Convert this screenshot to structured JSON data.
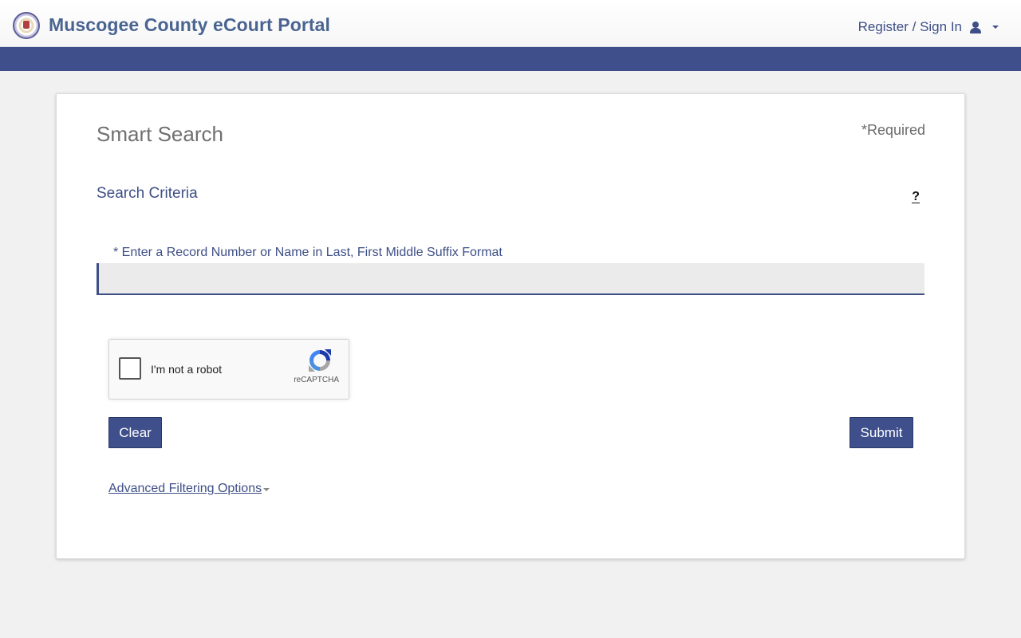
{
  "header": {
    "title": "Muscogee County eCourt Portal",
    "account_label": "Register / Sign In"
  },
  "search": {
    "page_title": "Smart Search",
    "required_note": "*Required",
    "section_title": "Search Criteria",
    "help_label": "?",
    "field_label": "* Enter a Record Number or Name in Last, First Middle Suffix Format",
    "field_value": ""
  },
  "captcha": {
    "label": "I'm not a robot",
    "brand": "reCAPTCHA"
  },
  "actions": {
    "clear_label": "Clear",
    "submit_label": "Submit"
  },
  "advanced": {
    "label": "Advanced Filtering Options"
  },
  "colors": {
    "brand": "#3e4f8c",
    "title": "#4a6491",
    "background": "#f1f1f1"
  },
  "icons": {
    "logo": "county-seal-logo",
    "account": "user-icon",
    "dropdown": "chevron-down-icon",
    "help": "question-mark-icon",
    "captcha": "recaptcha-icon"
  }
}
